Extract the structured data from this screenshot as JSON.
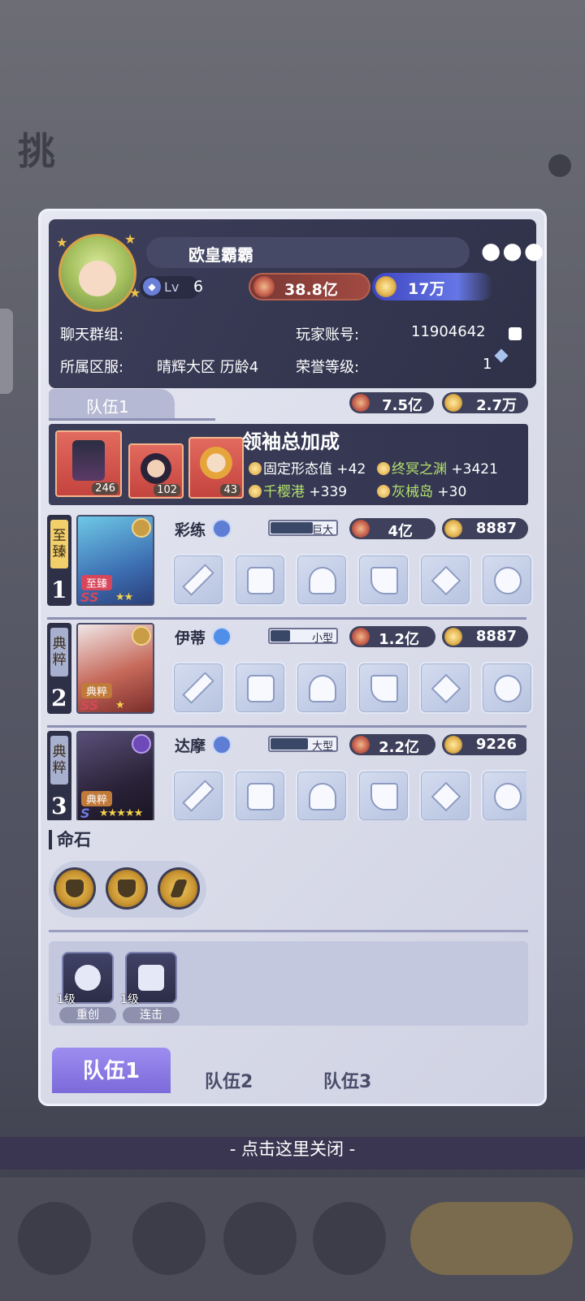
{
  "background": {
    "title_partial": "挑"
  },
  "profile": {
    "name": "欧皇霸霸",
    "level_label": "Lv",
    "level": "6",
    "power": "38.8亿",
    "diamonds": "17万",
    "chat_group_label": "聊天群组:",
    "account_label": "玩家账号:",
    "account_id": "11904642",
    "server_label": "所属区服:",
    "server_value": "晴辉大区  历龄4",
    "honor_label": "荣誉等级:",
    "honor_value": "1"
  },
  "team": {
    "tab_label": "队伍1",
    "power": "7.5亿",
    "diamonds": "2.7万"
  },
  "leader_bonus": {
    "title": "领袖总加成",
    "cards": [
      {
        "level": "246"
      },
      {
        "level": "102"
      },
      {
        "level": "43"
      }
    ],
    "items": [
      {
        "name": "固定形态值",
        "value": "+42"
      },
      {
        "name": "终冥之渊",
        "value": "+3421"
      },
      {
        "name": "千樱港",
        "value": "+339"
      },
      {
        "name": "灰械岛",
        "value": "+30"
      }
    ]
  },
  "heroes": [
    {
      "rank": "1",
      "quality": "至臻",
      "tag": "至臻",
      "stars": "★★",
      "name": "彩练",
      "size": "巨大",
      "power": "4亿",
      "score": "8887"
    },
    {
      "rank": "2",
      "quality": "典粹",
      "tag": "典粹",
      "stars": "★",
      "name": "伊蒂",
      "size": "小型",
      "power": "1.2亿",
      "score": "8887"
    },
    {
      "rank": "3",
      "quality": "典粹",
      "tag": "典粹",
      "stars": "★★★★★",
      "name": "达摩",
      "size": "大型",
      "power": "2.2亿",
      "score": "9226"
    }
  ],
  "fate_stone": {
    "title": "命石"
  },
  "skills": [
    {
      "level": "1级",
      "name": "重创"
    },
    {
      "level": "1级",
      "name": "连击"
    }
  ],
  "tabs": [
    "队伍1",
    "队伍2",
    "队伍3"
  ],
  "close_hint": "- 点击这里关闭 -",
  "colors": {
    "accent": "#7b6ad9",
    "panel_dark": "#3d3f5b",
    "power_red": "#a14a41",
    "diamond_blue": "#3d45c0"
  }
}
